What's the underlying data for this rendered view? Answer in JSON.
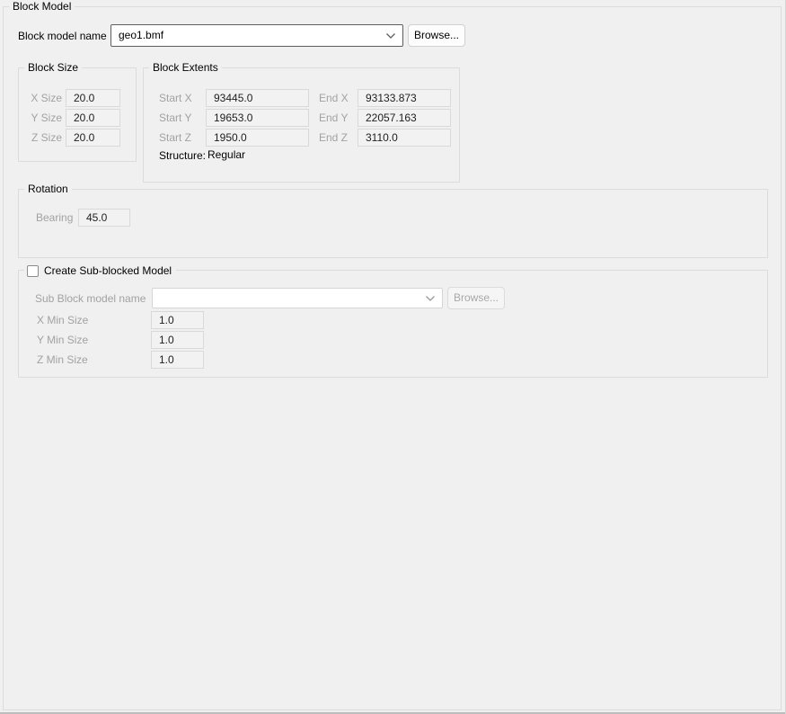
{
  "window": {
    "group_title": "Block Model"
  },
  "colors": {
    "background": "#f0f0f0",
    "group_border": "#dcdcdc",
    "disabled_label": "#a2a2a2",
    "field_background": "#f2f2f2",
    "field_border": "#d9d9d9",
    "combobox_border": "#5e5e5e",
    "button_border": "#d1d1d1",
    "text": "#000000"
  },
  "header": {
    "name_label": "Block model name",
    "name_value": "geo1.bmf",
    "browse_label": "Browse...",
    "chevron_icon": "chevron-down"
  },
  "block_size": {
    "title": "Block Size",
    "fields": [
      {
        "label": "X Size",
        "value": "20.0"
      },
      {
        "label": "Y Size",
        "value": "20.0"
      },
      {
        "label": "Z Size",
        "value": "20.0"
      }
    ]
  },
  "block_extents": {
    "title": "Block Extents",
    "start_fields": [
      {
        "label": "Start X",
        "value": "93445.0"
      },
      {
        "label": "Start Y",
        "value": "19653.0"
      },
      {
        "label": "Start Z",
        "value": "1950.0"
      }
    ],
    "end_fields": [
      {
        "label": "End X",
        "value": "93133.873"
      },
      {
        "label": "End Y",
        "value": "22057.163"
      },
      {
        "label": "End Z",
        "value": "3110.0"
      }
    ],
    "structure_label": "Structure:",
    "structure_value": "Regular"
  },
  "rotation": {
    "title": "Rotation",
    "bearing_label": "Bearing",
    "bearing_value": "45.0"
  },
  "sub_block": {
    "checkbox_label": "Create Sub-blocked Model",
    "checked": false,
    "name_label": "Sub Block model name",
    "name_value": "",
    "browse_label": "Browse...",
    "fields": [
      {
        "label": "X Min Size",
        "value": "1.0"
      },
      {
        "label": "Y Min Size",
        "value": "1.0"
      },
      {
        "label": "Z Min Size",
        "value": "1.0"
      }
    ]
  }
}
